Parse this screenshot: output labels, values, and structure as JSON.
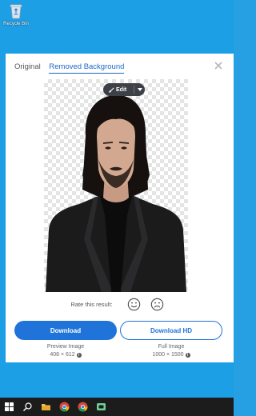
{
  "desktop": {
    "recycle_bin_label": "Recycle Bin"
  },
  "dialog": {
    "tabs": [
      {
        "label": "Original",
        "active": false
      },
      {
        "label": "Removed Background",
        "active": true
      }
    ],
    "close_icon": "close-icon",
    "edit": {
      "label": "Edit",
      "icon": "brush-icon",
      "caret_icon": "chevron-down-icon"
    },
    "rate": {
      "label": "Rate this result:",
      "positive_icon": "smile-icon",
      "negative_icon": "frown-icon"
    },
    "download": {
      "label": "Download",
      "caption": "Preview Image",
      "size": "408 × 612"
    },
    "download_hd": {
      "label": "Download HD",
      "caption": "Full Image",
      "size": "1000 × 1500"
    }
  },
  "taskbar": {
    "items": [
      "windows-start-icon",
      "search-icon",
      "file-explorer-icon",
      "chrome-icon",
      "chrome-icon",
      "store-app-icon"
    ]
  },
  "colors": {
    "accent": "#1f73d9",
    "desktop": "#1d9fe6",
    "taskbar": "#1c1c1c"
  }
}
